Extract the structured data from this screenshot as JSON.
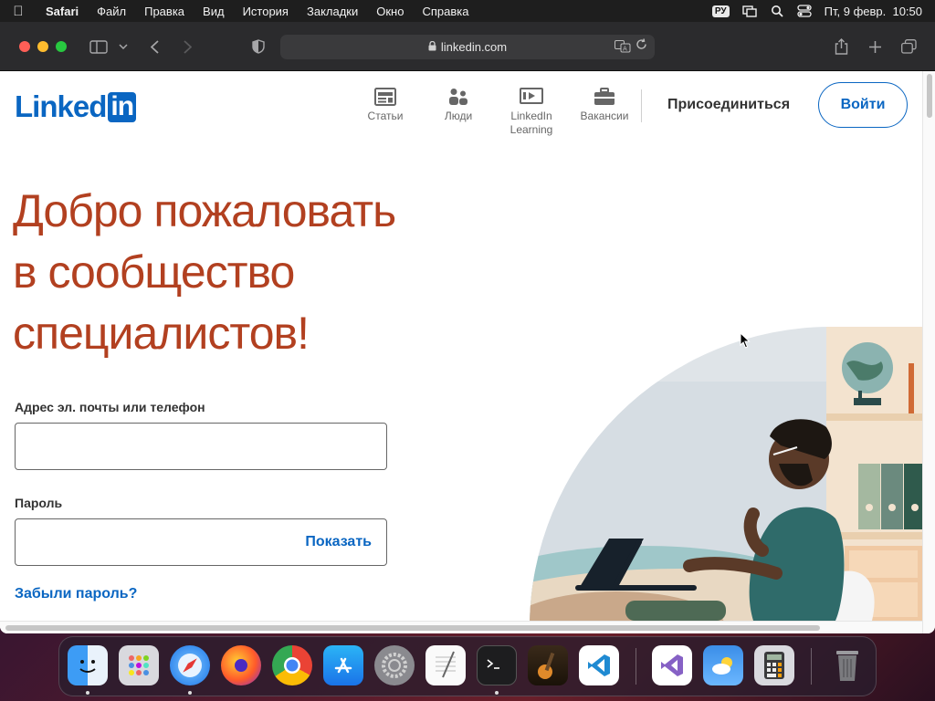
{
  "menubar": {
    "app_name": "Safari",
    "items": [
      "Файл",
      "Правка",
      "Вид",
      "История",
      "Закладки",
      "Окно",
      "Справка"
    ],
    "input_source": "РУ",
    "datetime": "Пт, 9 февр.  10:50"
  },
  "browser": {
    "url": "linkedin.com"
  },
  "header": {
    "logo_text": "Linked",
    "logo_badge": "in",
    "nav": [
      {
        "label": "Статьи",
        "icon": "articles-icon"
      },
      {
        "label": "Люди",
        "icon": "people-icon"
      },
      {
        "label": "LinkedIn Learning",
        "icon": "learning-icon"
      },
      {
        "label": "Вакансии",
        "icon": "jobs-icon"
      }
    ],
    "join_label": "Присоединиться",
    "signin_label": "Войти"
  },
  "main": {
    "headline_line1": "Добро пожаловать",
    "headline_line2": "в сообщество",
    "headline_line3": "специалистов!",
    "email_label": "Адрес эл. почты или телефон",
    "email_value": "",
    "password_label": "Пароль",
    "password_value": "",
    "show_label": "Показать",
    "forgot_label": "Забыли пароль?"
  },
  "dock": {
    "apps": [
      "Finder",
      "Launchpad",
      "Safari",
      "Firefox",
      "Chrome",
      "App Store",
      "System Settings",
      "TextEdit",
      "Terminal",
      "GarageBand",
      "Visual Studio Code",
      "Visual Studio",
      "Weather",
      "Calculator",
      "Trash"
    ]
  },
  "colors": {
    "linkedin_blue": "#0a66c2",
    "headline": "#b24020"
  }
}
